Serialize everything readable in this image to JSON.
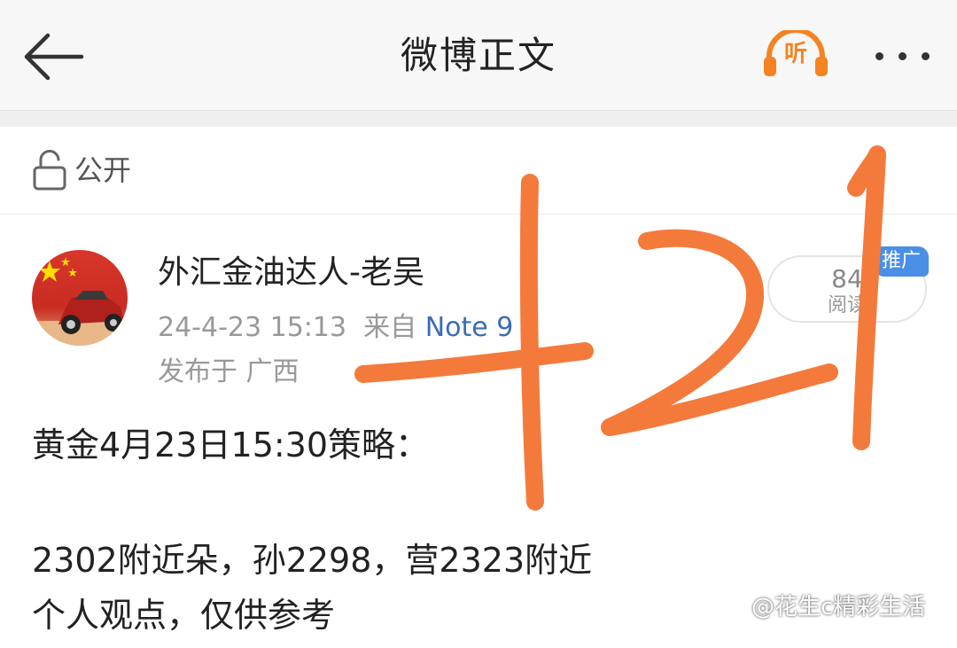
{
  "header": {
    "title": "微博正文",
    "listen_label": "听"
  },
  "visibility": {
    "label": "公开"
  },
  "post": {
    "author": "外汇金油达人-老吴",
    "time": "24-4-23 15:13",
    "from_prefix": "来自",
    "source": "Note 9",
    "location": "发布于 广西",
    "read_count": "84",
    "read_label": "阅读",
    "promo_badge": "推广",
    "lines": [
      "黄金4月23日15:30策略：",
      "2302附近朵，孙2298，营2323附近",
      "个人观点，仅供参考"
    ]
  },
  "overlay": {
    "handwritten_text": "+21"
  },
  "watermark": "@花生c精彩生活",
  "colors": {
    "accent_orange": "#f58322",
    "link_blue": "#3c6cb4",
    "badge_blue": "#4a8fe7",
    "handwriting": "#f47a3c"
  },
  "icons": {
    "back": "back-arrow-icon",
    "listen": "headphones-icon",
    "more": "more-dots-icon",
    "visibility": "unlock-icon"
  }
}
